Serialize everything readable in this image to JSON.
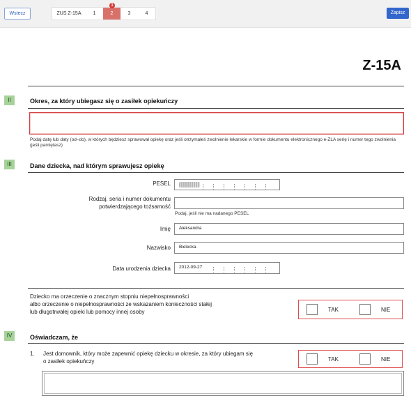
{
  "toolbar": {
    "back_label": "Wstecz",
    "save_label": "Zapisz",
    "tabs": [
      {
        "label": "ZUS Z-15A"
      },
      {
        "label": "1"
      },
      {
        "label": "2",
        "badge": "1"
      },
      {
        "label": "3"
      },
      {
        "label": "4"
      }
    ]
  },
  "form": {
    "code": "Z-15A",
    "section2": {
      "number": "II",
      "title": "Okres, za który ubiegasz się o zasiłek opiekuńczy",
      "period_value": "",
      "hint": "Podaj datę lub daty (od–do), w których będziesz sprawował opiekę oraz jeśli otrzymałeś zwolnienie lekarskie w formie dokumentu elektronicznego e-ZLA serię i numer tego zwolnienia (jeśli pamiętasz)"
    },
    "section3": {
      "number": "III",
      "title": "Dane dziecka, nad którym sprawujesz opiekę",
      "pesel_label": "PESEL",
      "document_label_line1": "Rodzaj, seria i numer dokumentu",
      "document_label_line2": "potwierdzającego tożsamość",
      "document_value": "",
      "document_hint": "Podaj, jeśli nie ma nadanego PESEL",
      "first_name_label": "Imię",
      "first_name_value": "Aleksandra",
      "last_name_label": "Nazwisko",
      "last_name_value": "Bielecka",
      "birth_date_label": "Data urodzenia dziecka",
      "birth_date_value": "2012-09-27",
      "disability_question_line1": "Dziecko ma orzeczenie o znacznym stopniu niepełnosprawności",
      "disability_question_line2": "albo orzeczenie o niepełnosprawności ze wskazaniem konieczności stałej",
      "disability_question_line3": "lub długotrwałej opieki lub pomocy innej osoby",
      "yes_label": "TAK",
      "no_label": "NIE"
    },
    "section4": {
      "number": "IV",
      "title": "Oświadczam, że",
      "item1_number": "1.",
      "item1_line1": "Jest domownik, który może zapewnić opiekę dziecku w okresie, za który ubiegam się",
      "item1_line2": "o zasiłek opiekuńczy",
      "yes_label": "TAK",
      "no_label": "NIE"
    }
  },
  "colors": {
    "accent": "#3366cc",
    "active_tab": "#d9716b",
    "error_border": "#e04b4b",
    "section_badge": "#a7d39a"
  }
}
